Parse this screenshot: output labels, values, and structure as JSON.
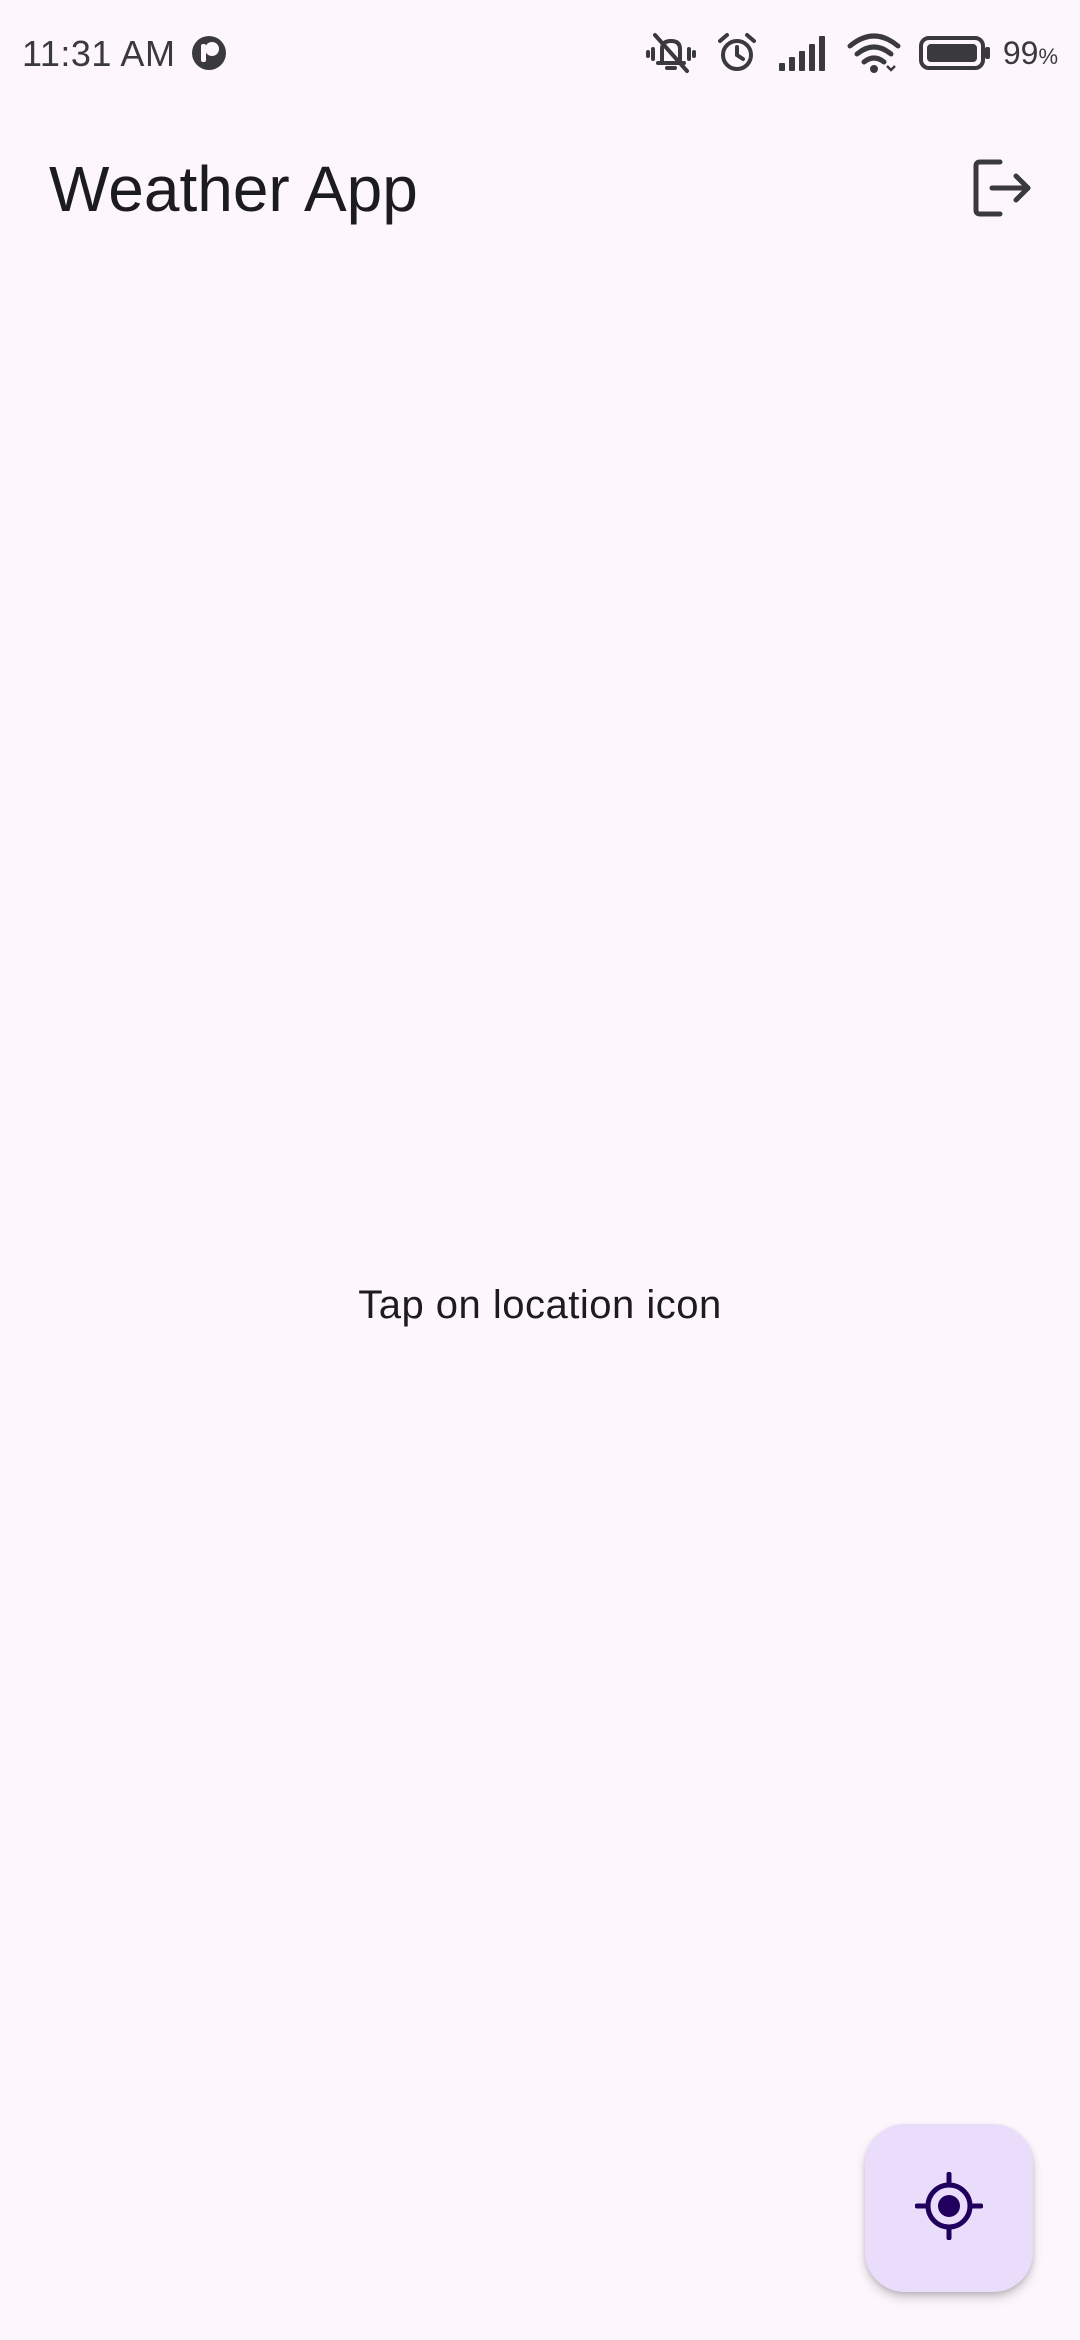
{
  "status_bar": {
    "time": "11:31 AM",
    "battery_percent": "99",
    "battery_pct_sign": "%",
    "icons": [
      "app-notification-icon",
      "vibrate-off-icon",
      "alarm-icon",
      "signal-icon",
      "wifi-icon",
      "battery-icon"
    ]
  },
  "app_bar": {
    "title": "Weather App",
    "logout_icon": "logout-icon"
  },
  "main": {
    "message": "Tap on location icon"
  },
  "fab": {
    "icon": "my-location-icon"
  },
  "colors": {
    "background": "#fdf7fd",
    "fab_background": "#eaddfb",
    "fab_icon": "#21005d",
    "text": "#1c1b1f"
  }
}
